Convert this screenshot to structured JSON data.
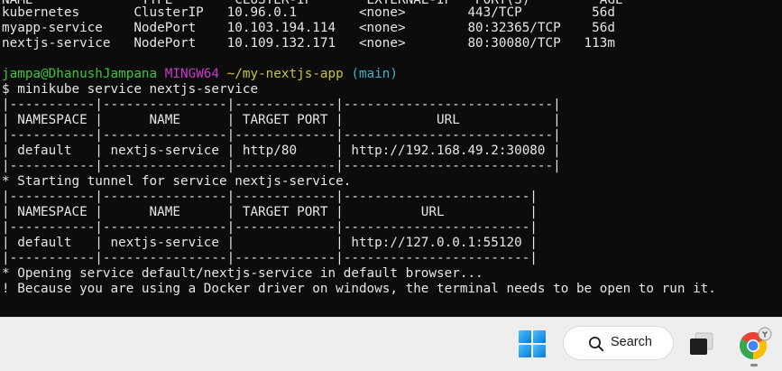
{
  "terminal": {
    "header_row": "NAME              TYPE        CLUSTER-IP       EXTERNAL-IP   PORT(S)         AGE",
    "rows": [
      "kubernetes       ClusterIP   10.96.0.1        <none>        443/TCP         56d",
      "myapp-service    NodePort    10.103.194.114   <none>        80:32365/TCP    56d",
      "nextjs-service   NodePort    10.109.132.171   <none>        80:30080/TCP   113m"
    ],
    "prompt": {
      "user_host": "jampa@DhanushJampana",
      "env": "MINGW64",
      "path": "~/my-nextjs-app",
      "branch": "(main)"
    },
    "command": "$ minikube service nextjs-service",
    "table1": [
      "|-----------|----------------|-------------|---------------------------|",
      "| NAMESPACE |      NAME      | TARGET PORT |            URL            |",
      "|-----------|----------------|-------------|---------------------------|",
      "| default   | nextjs-service | http/80     | http://192.168.49.2:30080 |",
      "|-----------|----------------|-------------|---------------------------|"
    ],
    "tunnel_msg": "* Starting tunnel for service nextjs-service.",
    "table2": [
      "|-----------|----------------|-------------|------------------------|",
      "| NAMESPACE |      NAME      | TARGET PORT |          URL           |",
      "|-----------|----------------|-------------|------------------------|",
      "| default   | nextjs-service |             | http://127.0.0.1:55120 |",
      "|-----------|----------------|-------------|------------------------|"
    ],
    "open_msg": "* Opening service default/nextjs-service in default browser...",
    "warn_msg": "! Because you are using a Docker driver on windows, the terminal needs to be open to run it."
  },
  "taskbar": {
    "search_label": "Search",
    "icons": [
      "windows-start-icon",
      "search-icon",
      "task-view-icon",
      "chrome-icon"
    ],
    "windows_blue": "#0a78d4"
  }
}
